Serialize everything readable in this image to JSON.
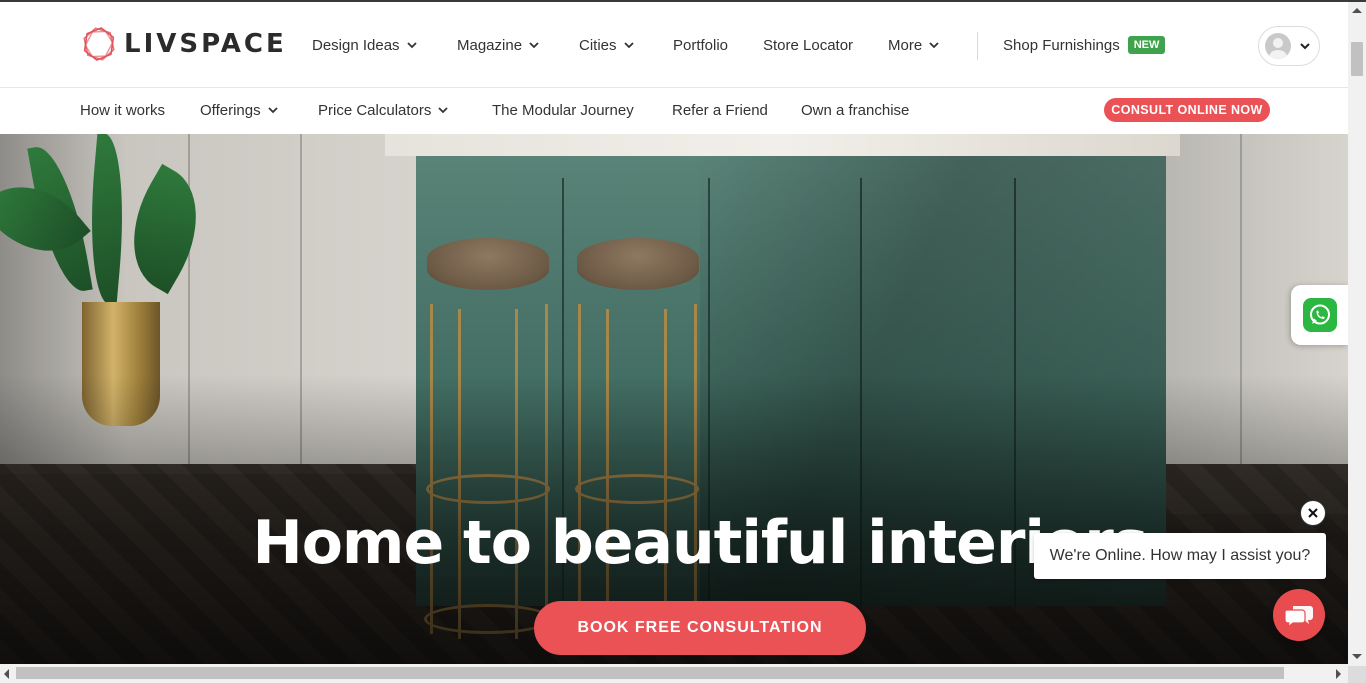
{
  "brand": {
    "name": "LIVSPACE",
    "logo_icon": "livspace-logo-icon",
    "accent": "#ea5256"
  },
  "main_nav": [
    {
      "label": "Design Ideas",
      "dropdown": true
    },
    {
      "label": "Magazine",
      "dropdown": true
    },
    {
      "label": "Cities",
      "dropdown": true
    },
    {
      "label": "Portfolio",
      "dropdown": false
    },
    {
      "label": "Store Locator",
      "dropdown": false
    },
    {
      "label": "More",
      "dropdown": true
    }
  ],
  "shop": {
    "label": "Shop Furnishings",
    "badge": "NEW",
    "badge_color": "#3fa34d"
  },
  "profile": {
    "icon": "user-avatar-icon"
  },
  "sub_nav": [
    {
      "label": "How it works",
      "dropdown": false
    },
    {
      "label": "Offerings",
      "dropdown": true
    },
    {
      "label": "Price Calculators",
      "dropdown": true
    },
    {
      "label": "The Modular Journey",
      "dropdown": false
    },
    {
      "label": "Refer a Friend",
      "dropdown": false
    },
    {
      "label": "Own a franchise",
      "dropdown": false
    }
  ],
  "consult_button": "CONSULT ONLINE NOW",
  "hero": {
    "title": "Home to beautiful interiors",
    "cta": "BOOK FREE CONSULTATION"
  },
  "chat": {
    "message": "We're Online. How may I assist you?",
    "color": "#e84c4f"
  },
  "whatsapp": {
    "icon": "whatsapp-icon",
    "color": "#2cb742"
  }
}
